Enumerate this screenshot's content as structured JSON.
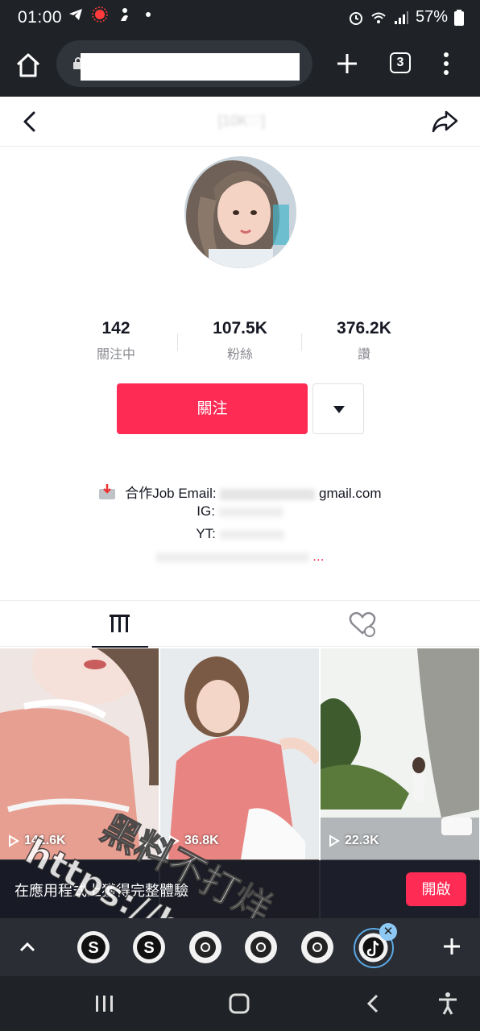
{
  "status_bar": {
    "time": "01:00",
    "battery": "57%",
    "icons": [
      "telegram-icon",
      "record-icon",
      "jump-icon",
      "dot-icon",
      "alarm-icon",
      "wifi-icon",
      "signal-icon",
      "battery-icon"
    ]
  },
  "browser": {
    "url": "",
    "tab_count": "3",
    "icons": [
      "home-icon",
      "lock-icon",
      "plus-icon",
      "menu-dots-icon"
    ]
  },
  "header": {
    "title": "[10K♡]",
    "icons": [
      "back-chevron-icon",
      "share-icon"
    ]
  },
  "profile": {
    "username": "",
    "stats": [
      {
        "value": "142",
        "label": "關注中"
      },
      {
        "value": "107.5K",
        "label": "粉絲"
      },
      {
        "value": "376.2K",
        "label": "讚"
      }
    ],
    "follow_label": "關注",
    "bio": {
      "line1": "",
      "email_prefix": "合作Job Email:",
      "email_suffix": "gmail.com",
      "ig_label": "IG:",
      "yt_label": "YT:",
      "more_dots": "..."
    }
  },
  "tabs": {
    "videos_icon": "grid-bars-icon",
    "liked_icon": "heart-hidden-icon"
  },
  "videos": [
    {
      "views": "141.6K"
    },
    {
      "views": "36.8K"
    },
    {
      "views": "22.3K"
    }
  ],
  "app_banner": {
    "text": "在應用程式上獲得完整體驗",
    "button": "開啟"
  },
  "watermark": {
    "line1": "黑料不打烊",
    "line2": "https://bdy6.co"
  },
  "colors": {
    "accent": "#fe2c55",
    "dark_chrome": "#1f2227",
    "text": "#161823",
    "muted": "#8a8b91"
  }
}
